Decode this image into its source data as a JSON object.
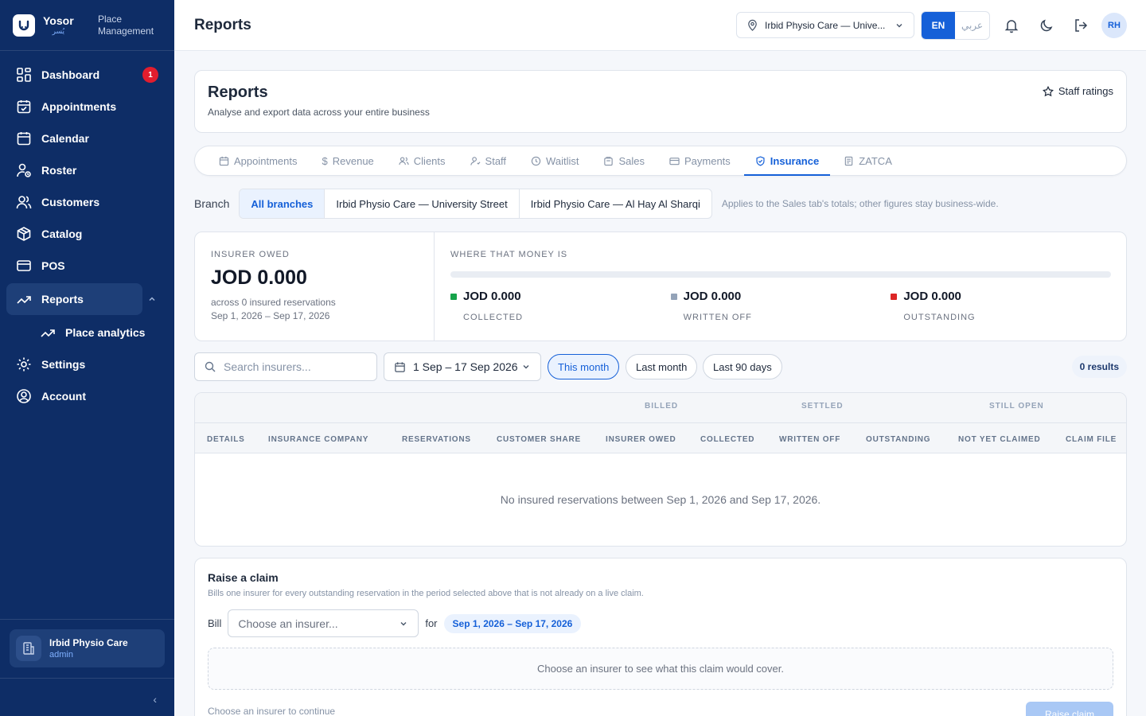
{
  "brand": {
    "name": "Yosor",
    "name_ar": "يُسر",
    "section": "Place Management"
  },
  "nav": {
    "items": [
      {
        "label": "Dashboard",
        "icon": "dashboard-icon",
        "badge": "1"
      },
      {
        "label": "Appointments",
        "icon": "calendar-check-icon"
      },
      {
        "label": "Calendar",
        "icon": "calendar-icon"
      },
      {
        "label": "Roster",
        "icon": "user-clock-icon"
      },
      {
        "label": "Customers",
        "icon": "users-icon"
      },
      {
        "label": "Catalog",
        "icon": "box-icon"
      },
      {
        "label": "POS",
        "icon": "card-icon"
      },
      {
        "label": "Reports",
        "icon": "trending-up-icon",
        "active": true
      },
      {
        "label": "Place analytics",
        "icon": "trending-up-icon",
        "sub": true
      },
      {
        "label": "Settings",
        "icon": "gear-icon"
      },
      {
        "label": "Account",
        "icon": "user-circle-icon"
      }
    ]
  },
  "place": {
    "name": "Irbid Physio Care",
    "role": "admin"
  },
  "topbar": {
    "title": "Reports",
    "location": "Irbid Physio Care — Unive...",
    "lang_en": "EN",
    "lang_ar": "عربي",
    "avatar": "RH"
  },
  "header": {
    "title": "Reports",
    "subtitle": "Analyse and export data across your entire business",
    "staff_ratings": "Staff ratings"
  },
  "tabs": [
    {
      "label": "Appointments",
      "icon": "calendar-icon"
    },
    {
      "label": "Revenue",
      "icon": "dollar-icon"
    },
    {
      "label": "Clients",
      "icon": "users-icon"
    },
    {
      "label": "Staff",
      "icon": "user-icon"
    },
    {
      "label": "Waitlist",
      "icon": "clock-icon"
    },
    {
      "label": "Sales",
      "icon": "bag-icon"
    },
    {
      "label": "Payments",
      "icon": "card-icon"
    },
    {
      "label": "Insurance",
      "icon": "shield-icon",
      "active": true
    },
    {
      "label": "ZATCA",
      "icon": "doc-icon"
    }
  ],
  "branch": {
    "label": "Branch",
    "options": [
      "All branches",
      "Irbid Physio Care — University Street",
      "Irbid Physio Care — Al Hay Al Sharqi"
    ],
    "selected": "All branches",
    "note": "Applies to the Sales tab's totals; other figures stay business-wide."
  },
  "summary": {
    "insurer_owed_label": "INSURER OWED",
    "insurer_owed_value": "JOD 0.000",
    "across": "across 0 insured reservations",
    "range": "Sep 1, 2026 – Sep 17, 2026",
    "where_label": "WHERE THAT MONEY IS",
    "breakdown": [
      {
        "value": "JOD 0.000",
        "label": "COLLECTED",
        "color": "#16a34a"
      },
      {
        "value": "JOD 0.000",
        "label": "WRITTEN OFF",
        "color": "#94a3b8"
      },
      {
        "value": "JOD 0.000",
        "label": "OUTSTANDING",
        "color": "#dc2626"
      }
    ]
  },
  "filters": {
    "search_placeholder": "Search insurers...",
    "date_range": "1 Sep – 17 Sep 2026",
    "presets": [
      "This month",
      "Last month",
      "Last 90 days"
    ],
    "active_preset": "This month",
    "results": "0 results"
  },
  "table": {
    "groups": [
      "BILLED",
      "SETTLED",
      "STILL OPEN"
    ],
    "columns": [
      "DETAILS",
      "INSURANCE COMPANY",
      "RESERVATIONS",
      "CUSTOMER SHARE",
      "INSURER OWED",
      "COLLECTED",
      "WRITTEN OFF",
      "OUTSTANDING",
      "NOT YET CLAIMED",
      "CLAIM FILE"
    ],
    "empty": "No insured reservations between Sep 1, 2026 and Sep 17, 2026."
  },
  "claim": {
    "title": "Raise a claim",
    "subtitle": "Bills one insurer for every outstanding reservation in the period selected above that is not already on a live claim.",
    "bill_label": "Bill",
    "select_placeholder": "Choose an insurer...",
    "for_label": "for",
    "range": "Sep 1, 2026 – Sep 17, 2026",
    "empty": "Choose an insurer to see what this claim would cover.",
    "footer": "Choose an insurer to continue",
    "button": "Raise claim"
  }
}
